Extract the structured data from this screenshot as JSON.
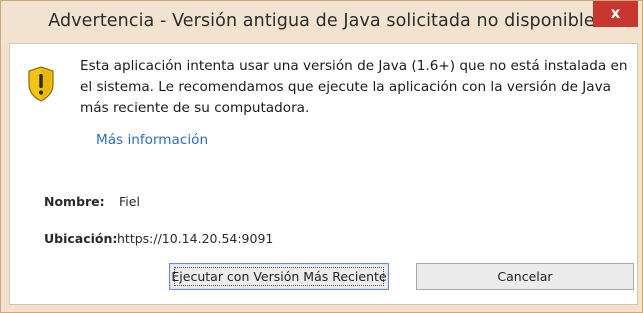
{
  "dialog": {
    "title": "Advertencia - Versión antigua de Java solicitada no disponible",
    "close_label": "x",
    "message": "Esta aplicación intenta usar una versión de Java (1.6+) que no está instalada en el sistema. Le recomendamos que ejecute la aplicación con la versión de Java más reciente de su computadora.",
    "more_info_link": "Más información",
    "fields": {
      "name_label": "Nombre:",
      "name_value": "Fiel",
      "location_label": "Ubicación:",
      "location_value": "https://10.14.20.54:9091"
    },
    "buttons": {
      "run_latest": "Ejecutar con Versión Más Reciente",
      "cancel": "Cancelar"
    },
    "icons": {
      "warning": "warning-shield-icon",
      "close": "close-icon"
    },
    "colors": {
      "titlebar": "#f1e3cf",
      "close_button": "#c7372f",
      "link": "#2e6fb7",
      "warning_yellow": "#f2c418"
    }
  }
}
